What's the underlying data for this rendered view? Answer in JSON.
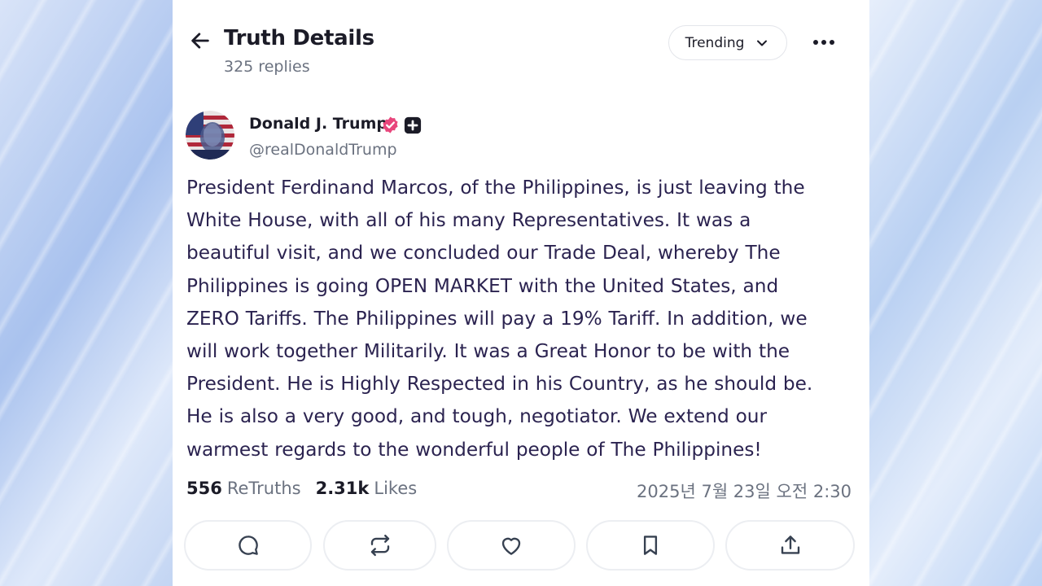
{
  "header": {
    "title": "Truth Details",
    "replies": "325 replies",
    "sort_label": "Trending"
  },
  "author": {
    "name": "Donald J. Trump",
    "handle": "@realDonaldTrump"
  },
  "post": {
    "lines": [
      "President Ferdinand Marcos, of the Philippines, is just leaving the",
      "White House, with all of his many Representatives. It was a",
      "beautiful visit, and we concluded our Trade Deal, whereby The",
      "Philippines is going OPEN MARKET with the United States, and",
      "ZERO Tariffs. The Philippines will pay a 19% Tariff. In addition, we",
      "will work together Militarily. It was a Great Honor to be with the",
      "President. He is Highly Respected in his Country, as he should be.",
      "He is also a very good, and tough, negotiator. We extend our",
      "warmest regards to the wonderful people of The Philippines!"
    ]
  },
  "stats": {
    "retruths_count": "556",
    "retruths_label": "ReTruths",
    "likes_count": "2.31k",
    "likes_label": "Likes",
    "timestamp": "2025년 7월 23일 오전 2:30"
  },
  "actions": [
    {
      "icon": "reply-icon"
    },
    {
      "icon": "retruth-icon"
    },
    {
      "icon": "like-icon"
    },
    {
      "icon": "bookmark-icon"
    },
    {
      "icon": "share-icon"
    }
  ],
  "colors": {
    "text": "#1b1b27",
    "body_text": "#2b2350",
    "muted": "#6b7280",
    "verified": "#e8467c",
    "border": "#eceef2"
  }
}
